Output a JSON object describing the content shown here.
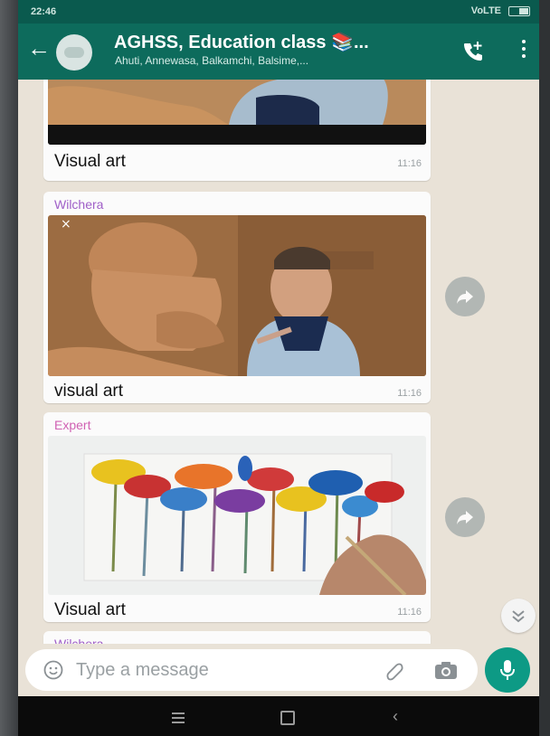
{
  "status_bar": {
    "time": "22:46",
    "network": "VoLTE"
  },
  "header": {
    "title": "AGHSS, Education class 📚...",
    "subtitle": "Ahuti, Annewasa, Balkamchi, Balsime,..."
  },
  "messages": [
    {
      "sender": "",
      "caption": "Visual art",
      "time": "11:16"
    },
    {
      "sender": "Wilchera",
      "caption": "visual art",
      "time": "11:16",
      "sender_color": "#a05fc8"
    },
    {
      "sender": "Expert",
      "caption": "Visual art",
      "time": "11:16",
      "sender_color": "#d062b3"
    },
    {
      "sender": "Wilchera",
      "sender_color": "#a05fc8"
    }
  ],
  "composer": {
    "placeholder": "Type a message"
  },
  "colors": {
    "header": "#0d6b5c",
    "status": "#0a5a4e",
    "accent": "#0d9a85",
    "wallpaper": "#e9e2d7"
  },
  "icons": [
    "back-arrow-icon",
    "add-call-icon",
    "menu-dots-icon",
    "forward-icon",
    "scroll-down-icon",
    "emoji-icon",
    "attach-icon",
    "camera-icon",
    "mic-icon"
  ]
}
